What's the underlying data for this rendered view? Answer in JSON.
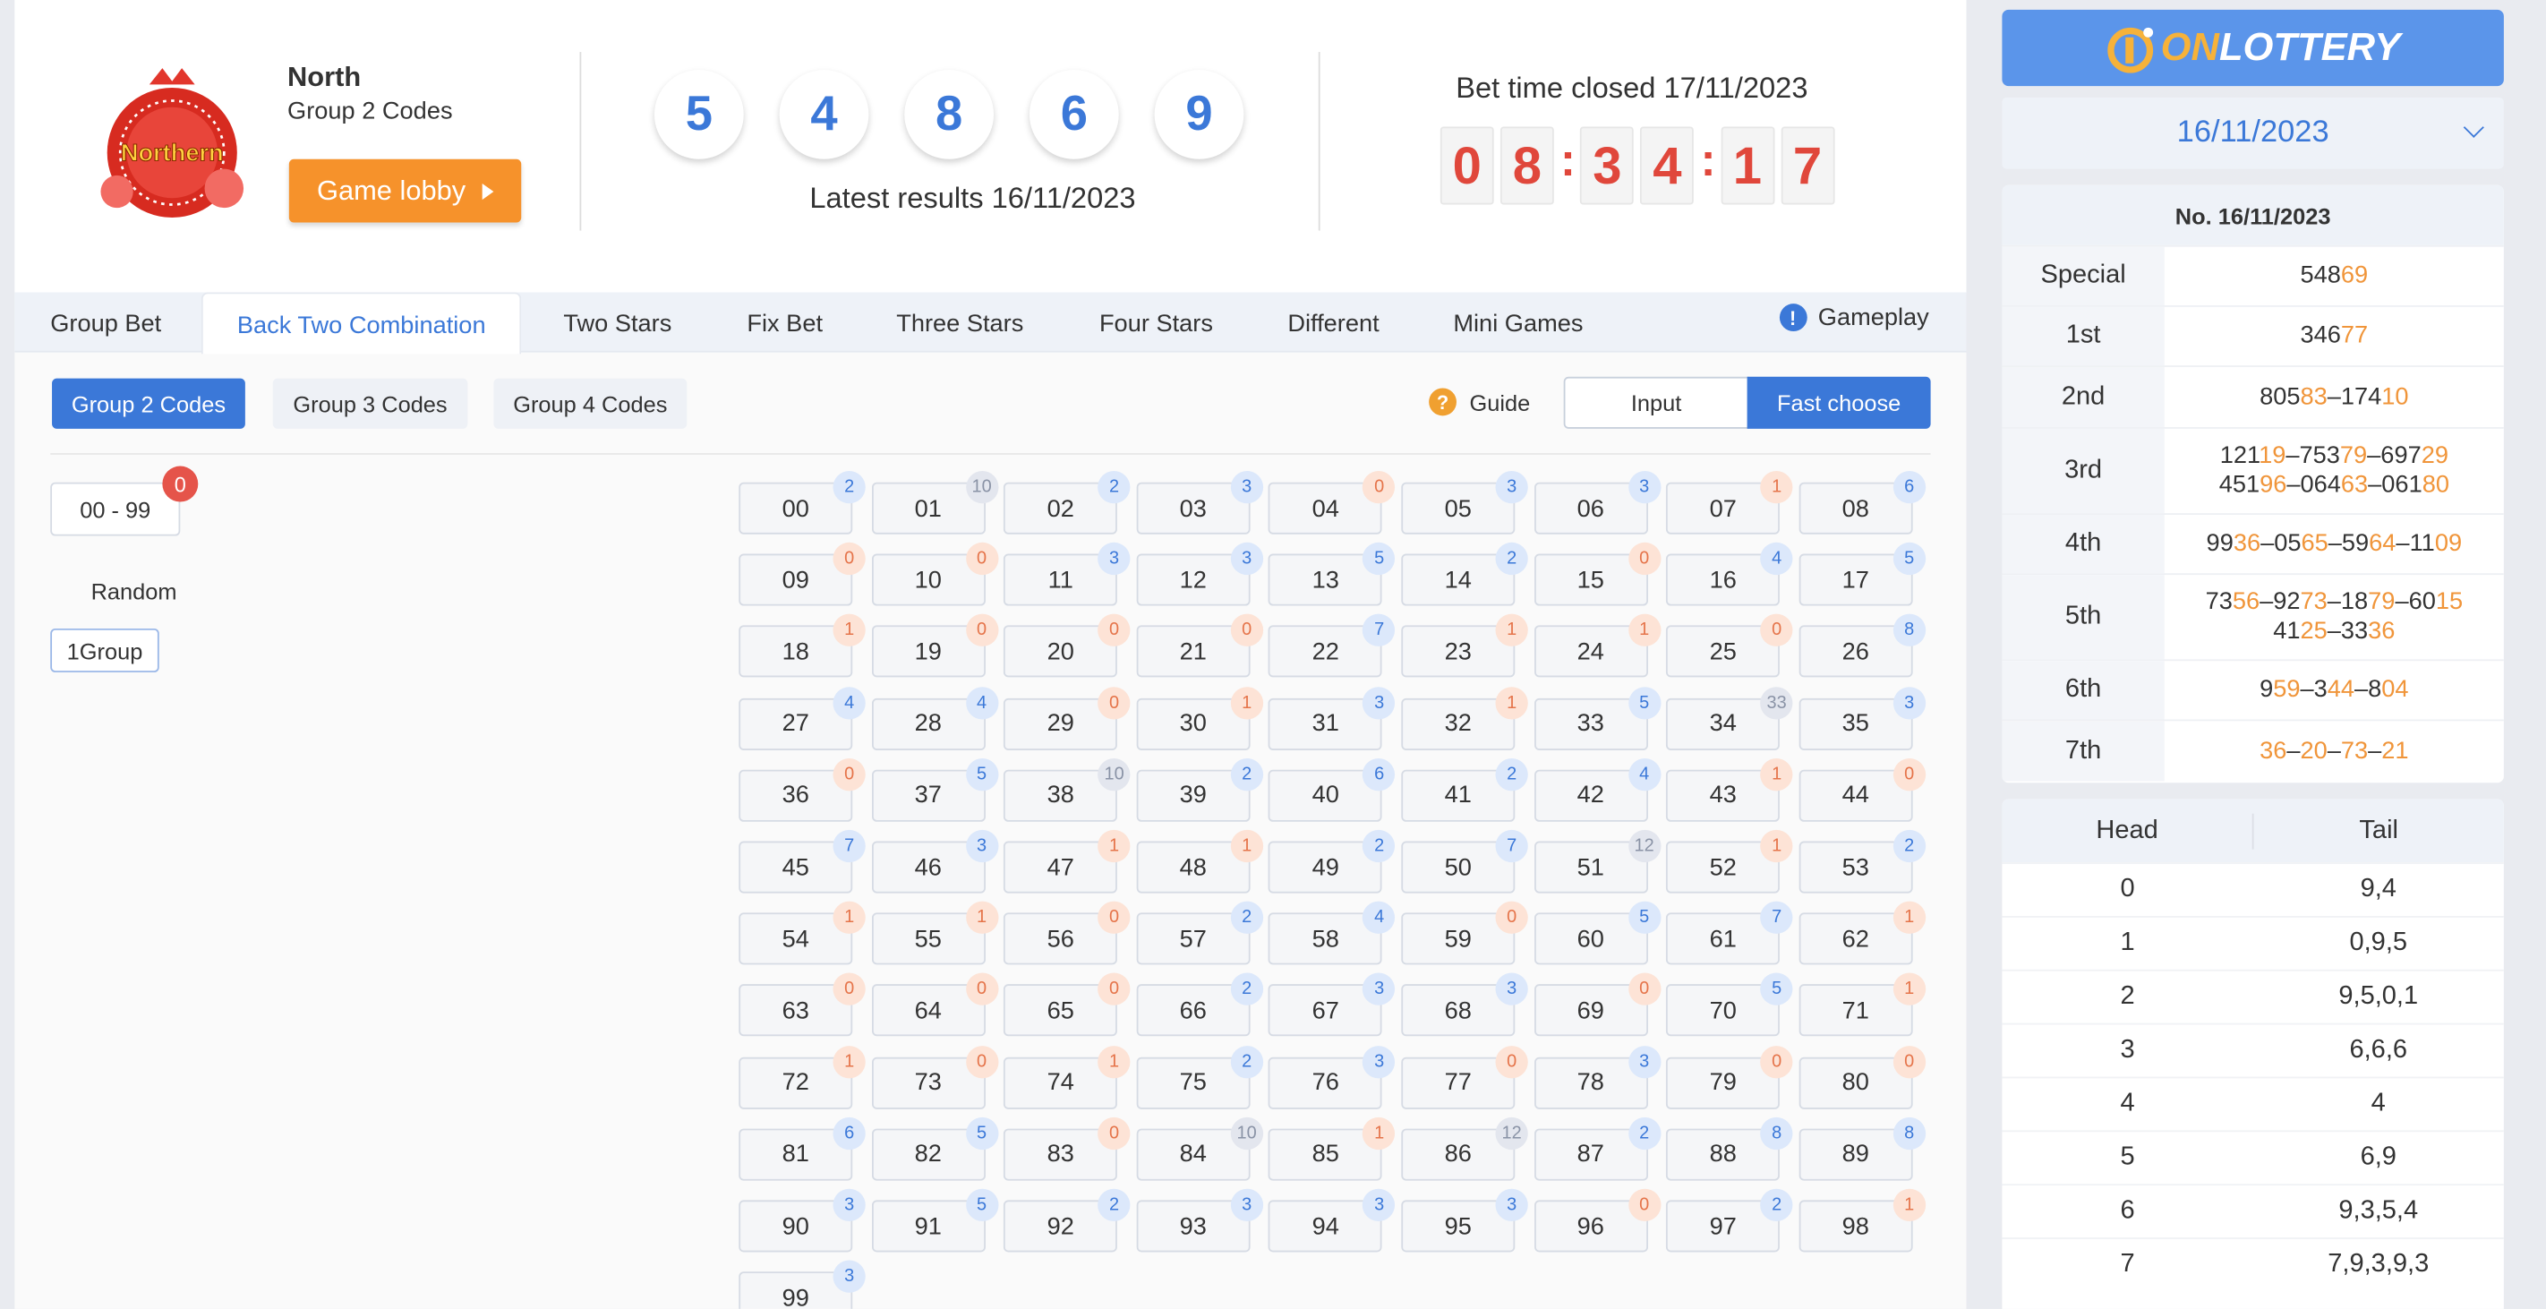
{
  "header": {
    "logo_text": "Northern",
    "region": "North",
    "mode": "Group 2 Codes",
    "lobby_label": "Game lobby",
    "balls": [
      "5",
      "4",
      "8",
      "6",
      "9"
    ],
    "latest_results": "Latest results 16/11/2023",
    "bet_closed": "Bet time closed 17/11/2023",
    "timer": [
      "0",
      "8",
      "3",
      "4",
      "1",
      "7"
    ]
  },
  "tabs": [
    {
      "label": "Group Bet"
    },
    {
      "label": "Back Two Combination"
    },
    {
      "label": "Two Stars"
    },
    {
      "label": "Fix Bet"
    },
    {
      "label": "Three Stars"
    },
    {
      "label": "Four Stars"
    },
    {
      "label": "Different"
    },
    {
      "label": "Mini Games"
    }
  ],
  "gameplay_label": "Gameplay",
  "subtabs": [
    {
      "label": "Group 2 Codes"
    },
    {
      "label": "Group 3 Codes"
    },
    {
      "label": "Group 4 Codes"
    }
  ],
  "guide_label": "Guide",
  "mode_toggle": {
    "input": "Input",
    "fast": "Fast choose"
  },
  "range_label": "00 - 99",
  "range_badge": "0",
  "random_label": "Random",
  "group_label": "1Group",
  "numbers": [
    {
      "n": "00",
      "c": "2"
    },
    {
      "n": "01",
      "c": "10"
    },
    {
      "n": "02",
      "c": "2"
    },
    {
      "n": "03",
      "c": "3"
    },
    {
      "n": "04",
      "c": "0"
    },
    {
      "n": "05",
      "c": "3"
    },
    {
      "n": "06",
      "c": "3"
    },
    {
      "n": "07",
      "c": "1"
    },
    {
      "n": "08",
      "c": "6"
    },
    {
      "n": "09",
      "c": "0"
    },
    {
      "n": "10",
      "c": "0"
    },
    {
      "n": "11",
      "c": "3"
    },
    {
      "n": "12",
      "c": "3"
    },
    {
      "n": "13",
      "c": "5"
    },
    {
      "n": "14",
      "c": "2"
    },
    {
      "n": "15",
      "c": "0"
    },
    {
      "n": "16",
      "c": "4"
    },
    {
      "n": "17",
      "c": "5"
    },
    {
      "n": "18",
      "c": "1"
    },
    {
      "n": "19",
      "c": "0"
    },
    {
      "n": "20",
      "c": "0"
    },
    {
      "n": "21",
      "c": "0"
    },
    {
      "n": "22",
      "c": "7"
    },
    {
      "n": "23",
      "c": "1"
    },
    {
      "n": "24",
      "c": "1"
    },
    {
      "n": "25",
      "c": "0"
    },
    {
      "n": "26",
      "c": "8"
    },
    {
      "n": "27",
      "c": "4"
    },
    {
      "n": "28",
      "c": "4"
    },
    {
      "n": "29",
      "c": "0"
    },
    {
      "n": "30",
      "c": "1"
    },
    {
      "n": "31",
      "c": "3"
    },
    {
      "n": "32",
      "c": "1"
    },
    {
      "n": "33",
      "c": "5"
    },
    {
      "n": "34",
      "c": "33"
    },
    {
      "n": "35",
      "c": "3"
    },
    {
      "n": "36",
      "c": "0"
    },
    {
      "n": "37",
      "c": "5"
    },
    {
      "n": "38",
      "c": "10"
    },
    {
      "n": "39",
      "c": "2"
    },
    {
      "n": "40",
      "c": "6"
    },
    {
      "n": "41",
      "c": "2"
    },
    {
      "n": "42",
      "c": "4"
    },
    {
      "n": "43",
      "c": "1"
    },
    {
      "n": "44",
      "c": "0"
    },
    {
      "n": "45",
      "c": "7"
    },
    {
      "n": "46",
      "c": "3"
    },
    {
      "n": "47",
      "c": "1"
    },
    {
      "n": "48",
      "c": "1"
    },
    {
      "n": "49",
      "c": "2"
    },
    {
      "n": "50",
      "c": "7"
    },
    {
      "n": "51",
      "c": "12"
    },
    {
      "n": "52",
      "c": "1"
    },
    {
      "n": "53",
      "c": "2"
    },
    {
      "n": "54",
      "c": "1"
    },
    {
      "n": "55",
      "c": "1"
    },
    {
      "n": "56",
      "c": "0"
    },
    {
      "n": "57",
      "c": "2"
    },
    {
      "n": "58",
      "c": "4"
    },
    {
      "n": "59",
      "c": "0"
    },
    {
      "n": "60",
      "c": "5"
    },
    {
      "n": "61",
      "c": "7"
    },
    {
      "n": "62",
      "c": "1"
    },
    {
      "n": "63",
      "c": "0"
    },
    {
      "n": "64",
      "c": "0"
    },
    {
      "n": "65",
      "c": "0"
    },
    {
      "n": "66",
      "c": "2"
    },
    {
      "n": "67",
      "c": "3"
    },
    {
      "n": "68",
      "c": "3"
    },
    {
      "n": "69",
      "c": "0"
    },
    {
      "n": "70",
      "c": "5"
    },
    {
      "n": "71",
      "c": "1"
    },
    {
      "n": "72",
      "c": "1"
    },
    {
      "n": "73",
      "c": "0"
    },
    {
      "n": "74",
      "c": "1"
    },
    {
      "n": "75",
      "c": "2"
    },
    {
      "n": "76",
      "c": "3"
    },
    {
      "n": "77",
      "c": "0"
    },
    {
      "n": "78",
      "c": "3"
    },
    {
      "n": "79",
      "c": "0"
    },
    {
      "n": "80",
      "c": "0"
    },
    {
      "n": "81",
      "c": "6"
    },
    {
      "n": "82",
      "c": "5"
    },
    {
      "n": "83",
      "c": "0"
    },
    {
      "n": "84",
      "c": "10"
    },
    {
      "n": "85",
      "c": "1"
    },
    {
      "n": "86",
      "c": "12"
    },
    {
      "n": "87",
      "c": "2"
    },
    {
      "n": "88",
      "c": "8"
    },
    {
      "n": "89",
      "c": "8"
    },
    {
      "n": "90",
      "c": "3"
    },
    {
      "n": "91",
      "c": "5"
    },
    {
      "n": "92",
      "c": "2"
    },
    {
      "n": "93",
      "c": "3"
    },
    {
      "n": "94",
      "c": "3"
    },
    {
      "n": "95",
      "c": "3"
    },
    {
      "n": "96",
      "c": "0"
    },
    {
      "n": "97",
      "c": "2"
    },
    {
      "n": "98",
      "c": "1"
    },
    {
      "n": "99",
      "c": "3"
    }
  ],
  "brand": {
    "prefix": "ON",
    "name": "LOTTERY"
  },
  "date_select": "16/11/2023",
  "results": {
    "title": "No. 16/11/2023",
    "rows": [
      {
        "label": "Special",
        "lines": [
          [
            [
              "548",
              0
            ],
            [
              "69",
              1
            ]
          ]
        ]
      },
      {
        "label": "1st",
        "lines": [
          [
            [
              "346",
              0
            ],
            [
              "77",
              1
            ]
          ]
        ]
      },
      {
        "label": "2nd",
        "lines": [
          [
            [
              "805",
              0
            ],
            [
              "83",
              1
            ],
            [
              "–174",
              0
            ],
            [
              "10",
              1
            ]
          ]
        ]
      },
      {
        "label": "3rd",
        "lines": [
          [
            [
              "121",
              0
            ],
            [
              "19",
              1
            ],
            [
              "–753",
              0
            ],
            [
              "79",
              1
            ],
            [
              "–697",
              0
            ],
            [
              "29",
              1
            ]
          ],
          [
            [
              "451",
              0
            ],
            [
              "96",
              1
            ],
            [
              "–064",
              0
            ],
            [
              "63",
              1
            ],
            [
              "–061",
              0
            ],
            [
              "80",
              1
            ]
          ]
        ]
      },
      {
        "label": "4th",
        "lines": [
          [
            [
              "99",
              0
            ],
            [
              "36",
              1
            ],
            [
              "–05",
              0
            ],
            [
              "65",
              1
            ],
            [
              "–59",
              0
            ],
            [
              "64",
              1
            ],
            [
              "–11",
              0
            ],
            [
              "09",
              1
            ]
          ]
        ]
      },
      {
        "label": "5th",
        "lines": [
          [
            [
              "73",
              0
            ],
            [
              "56",
              1
            ],
            [
              "–92",
              0
            ],
            [
              "73",
              1
            ],
            [
              "–18",
              0
            ],
            [
              "79",
              1
            ],
            [
              "–60",
              0
            ],
            [
              "15",
              1
            ]
          ],
          [
            [
              "41",
              0
            ],
            [
              "25",
              1
            ],
            [
              "–33",
              0
            ],
            [
              "36",
              1
            ]
          ]
        ]
      },
      {
        "label": "6th",
        "lines": [
          [
            [
              "9",
              0
            ],
            [
              "59",
              1
            ],
            [
              "–3",
              0
            ],
            [
              "44",
              1
            ],
            [
              "–8",
              0
            ],
            [
              "04",
              1
            ]
          ]
        ]
      },
      {
        "label": "7th",
        "lines": [
          [
            [
              "36",
              1
            ],
            [
              "–",
              0
            ],
            [
              "20",
              1
            ],
            [
              "–",
              0
            ],
            [
              "73",
              1
            ],
            [
              "–",
              0
            ],
            [
              "21",
              1
            ]
          ]
        ]
      }
    ]
  },
  "head_tail": {
    "head_label": "Head",
    "tail_label": "Tail",
    "rows": [
      {
        "h": "0",
        "t": "9,4"
      },
      {
        "h": "1",
        "t": "0,9,5"
      },
      {
        "h": "2",
        "t": "9,5,0,1"
      },
      {
        "h": "3",
        "t": "6,6,6"
      },
      {
        "h": "4",
        "t": "4"
      },
      {
        "h": "5",
        "t": "6,9"
      },
      {
        "h": "6",
        "t": "9,3,5,4"
      },
      {
        "h": "7",
        "t": "7,9,3,9,3"
      }
    ]
  },
  "colors": {
    "accent": "#3b78d8",
    "orange": "#f6922b",
    "red": "#e0473b",
    "highlight": "#f0953a"
  }
}
